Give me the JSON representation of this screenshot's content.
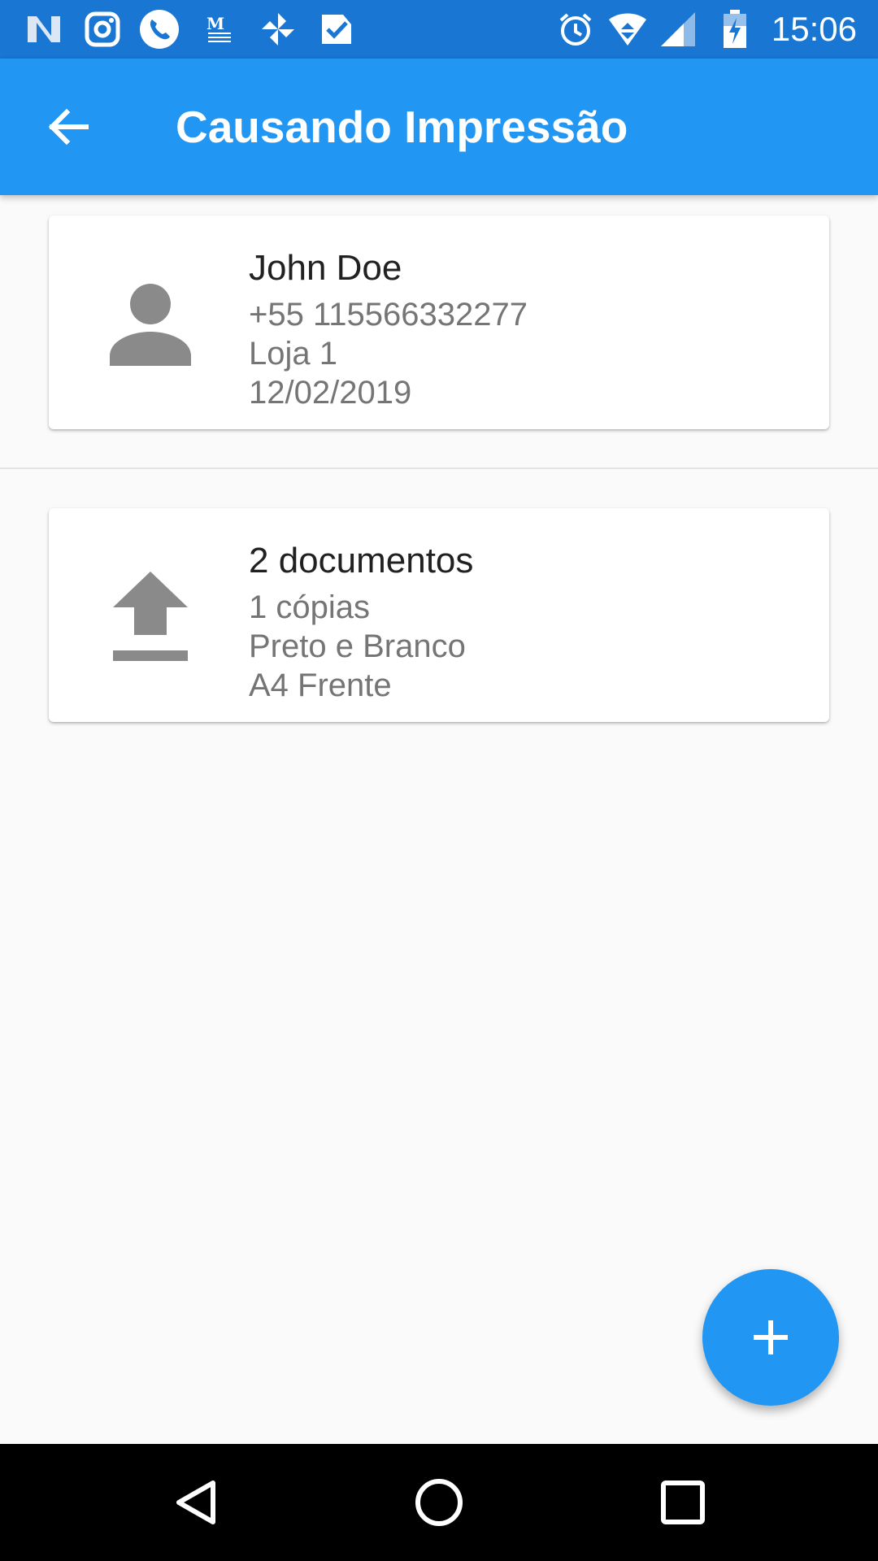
{
  "status_bar": {
    "time": "15:06",
    "left_icons": [
      "n-notification-icon",
      "instagram-icon",
      "phone-icon",
      "message-icon",
      "pinwheel-icon",
      "check-app-icon"
    ],
    "right_icons": [
      "alarm-icon",
      "wifi-icon",
      "signal-icon",
      "battery-icon"
    ]
  },
  "app_bar": {
    "title": "Causando Impressão",
    "back_icon": "arrow-back-icon"
  },
  "customer_card": {
    "icon": "person-icon",
    "name": "John Doe",
    "phone": "+55 115566332277",
    "store": "Loja 1",
    "date": "12/02/2019"
  },
  "document_card": {
    "icon": "upload-icon",
    "title": "2 documentos",
    "copies": "1 cópias",
    "color_mode": "Preto e Branco",
    "paper": "A4 Frente"
  },
  "fab": {
    "icon": "add-icon"
  },
  "nav_bar": {
    "icons": [
      "nav-back-icon",
      "nav-home-icon",
      "nav-recents-icon"
    ]
  },
  "colors": {
    "primary": "#2196f3",
    "primary_dark": "#1976d2",
    "background": "#fafafa",
    "icon_grey": "#8a8a8a"
  }
}
